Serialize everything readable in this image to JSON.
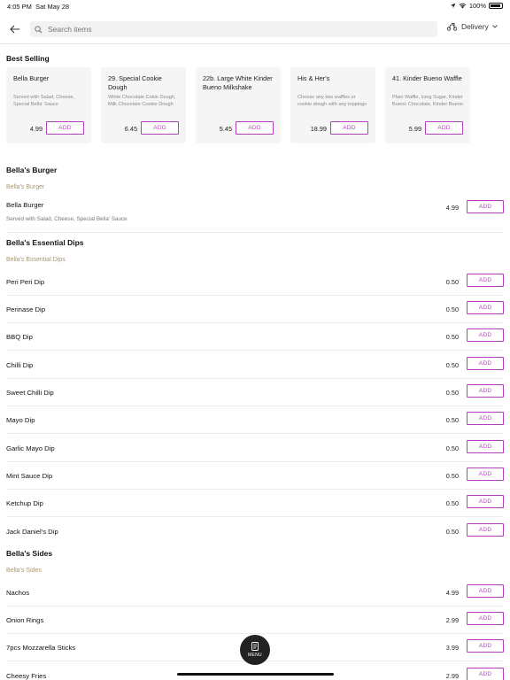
{
  "status": {
    "time": "4:05 PM",
    "date": "Sat May 28",
    "battery": "100%"
  },
  "search": {
    "placeholder": "Search items"
  },
  "delivery": {
    "label": "Delivery"
  },
  "best_selling": {
    "title": "Best Selling",
    "cards": [
      {
        "name": "Bella Burger",
        "desc": "Served with Salad, Cheese, Special Bella' Sauce",
        "price": "4.99",
        "add": "ADD"
      },
      {
        "name": "29. Special Cookie Dough",
        "desc": "White Chocolate Cokie Dough, Milk Chocolate Cookie Dough",
        "price": "6.45",
        "add": "ADD"
      },
      {
        "name": "22b. Large White Kinder Bueno Milkshake",
        "desc": "",
        "price": "5.45",
        "add": "ADD"
      },
      {
        "name": "His & Her's",
        "desc": "Choose any two waffles or cookie dough with any toppings",
        "price": "18.99",
        "add": "ADD"
      },
      {
        "name": "41. Kinder Bueno Waffle",
        "desc": "Plain Waffle, Icing Sugar, Kinder Bueno Chocolate, Kinder Bueno",
        "price": "5.99",
        "add": "ADD"
      }
    ]
  },
  "sections": [
    {
      "title": "Bella's Burger",
      "subtitle": "Bella's Burger",
      "items": [
        {
          "name": "Bella Burger",
          "desc": "Served with Salad, Cheese, Special Bella' Sauce",
          "price": "4.99",
          "add": "ADD"
        }
      ]
    },
    {
      "title": "Bella's Essential Dips",
      "subtitle": "Bella's Essential Dips",
      "items": [
        {
          "name": "Peri Peri Dip",
          "price": "0.50",
          "add": "ADD"
        },
        {
          "name": "Perinase Dip",
          "price": "0.50",
          "add": "ADD"
        },
        {
          "name": "BBQ Dip",
          "price": "0.50",
          "add": "ADD"
        },
        {
          "name": "Chilli Dip",
          "price": "0.50",
          "add": "ADD"
        },
        {
          "name": "Sweet Chilli Dip",
          "price": "0.50",
          "add": "ADD"
        },
        {
          "name": "Mayo Dip",
          "price": "0.50",
          "add": "ADD"
        },
        {
          "name": "Garlic Mayo Dip",
          "price": "0.50",
          "add": "ADD"
        },
        {
          "name": "Mint Sauce Dip",
          "price": "0.50",
          "add": "ADD"
        },
        {
          "name": "Ketchup Dip",
          "price": "0.50",
          "add": "ADD"
        },
        {
          "name": "Jack Daniel's Dip",
          "price": "0.50",
          "add": "ADD"
        }
      ]
    },
    {
      "title": "Bella's Sides",
      "subtitle": "Bella's Sides",
      "items": [
        {
          "name": "Nachos",
          "price": "4.99",
          "add": "ADD"
        },
        {
          "name": "Onion Rings",
          "price": "2.99",
          "add": "ADD"
        },
        {
          "name": "7pcs Mozzarella Sticks",
          "price": "3.99",
          "add": "ADD"
        },
        {
          "name": "Cheesy Fries",
          "price": "2.99",
          "add": "ADD"
        }
      ]
    }
  ],
  "menu_button": {
    "label": "MENU"
  },
  "colors": {
    "accent": "#b33fbf",
    "subtitle": "#a89873",
    "card_bg": "#f5f5f5"
  }
}
